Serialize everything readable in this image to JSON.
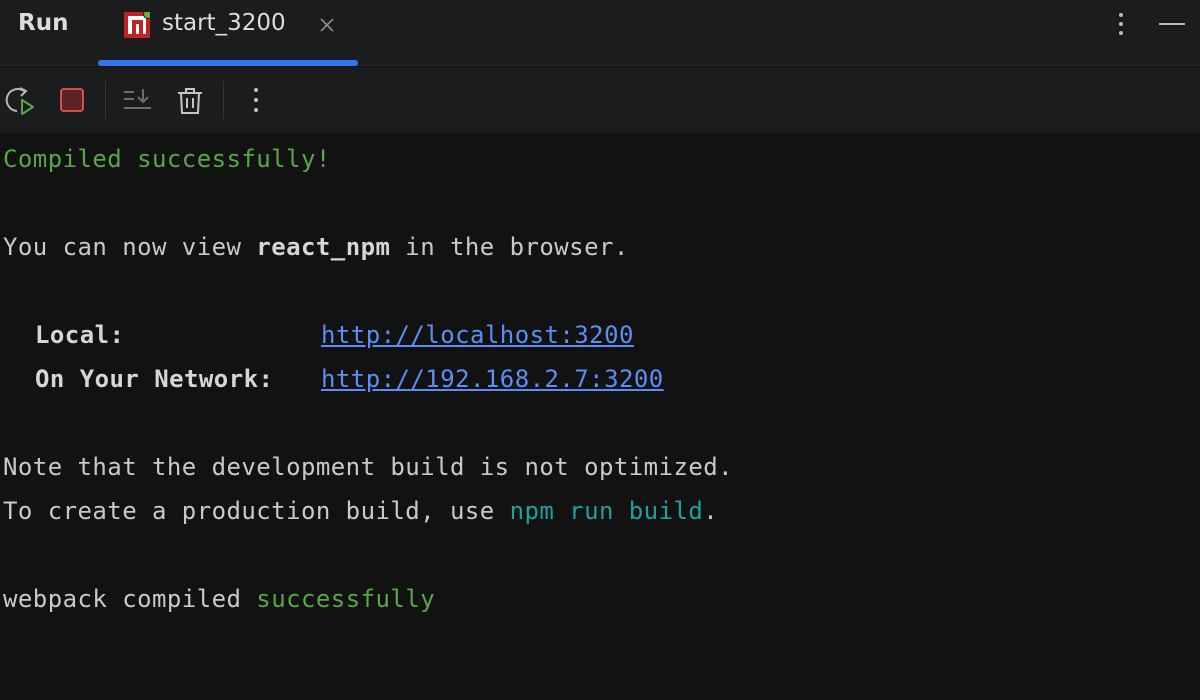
{
  "header": {
    "title": "Run",
    "tab": {
      "label": "start_3200",
      "active": true
    }
  },
  "toolbar": {
    "buttons": [
      "rerun-icon",
      "stop-icon",
      "scroll-to-end-icon",
      "clear-all-icon",
      "more-icon"
    ]
  },
  "console": {
    "compiled": "Compiled successfully!",
    "view_prefix": "You can now view ",
    "app_name": "react_npm",
    "view_suffix": " in the browser.",
    "local_label": "Local:",
    "local_url": "http://localhost:3200",
    "network_label": "On Your Network:",
    "network_url": "http://192.168.2.7:3200",
    "note": "Note that the development build is not optimized.",
    "prod_prefix": "To create a production build, use ",
    "prod_cmd": "npm run build",
    "prod_suffix": ".",
    "webpack_prefix": "webpack compiled ",
    "webpack_status": "successfully"
  },
  "colors": {
    "accent": "#3574f0",
    "success": "#57a64a",
    "command": "#1ea1a1",
    "link": "#5c8ef5",
    "background": "#121212"
  }
}
